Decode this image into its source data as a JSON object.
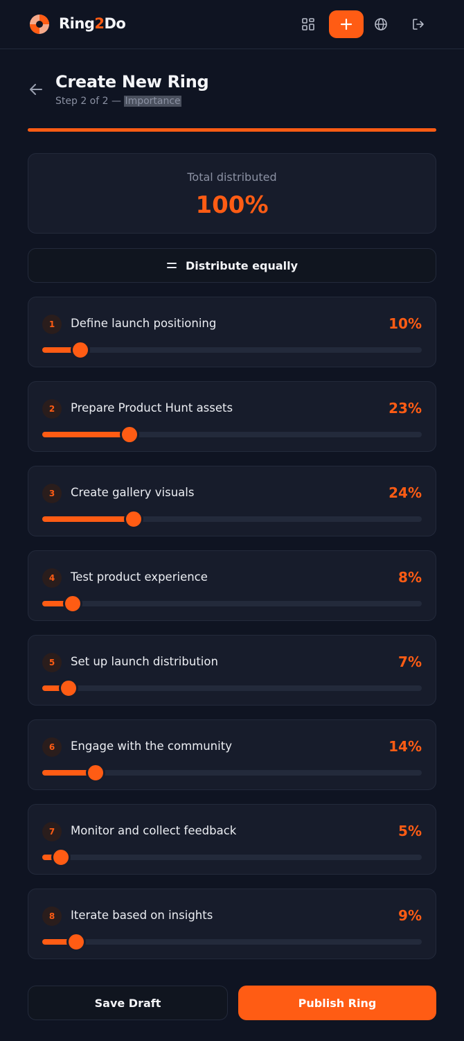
{
  "app": {
    "brand_part1": "Ring",
    "brand_part2": "2",
    "brand_part3": "Do",
    "accent_color": "#ff5c14"
  },
  "topbar": {
    "icons": [
      "grid-icon",
      "plus-icon",
      "globe-icon",
      "logout-icon"
    ]
  },
  "header": {
    "title": "Create New Ring",
    "step_text": "Step 2 of 2 — ",
    "step_name": "Importance"
  },
  "summary": {
    "label": "Total distributed",
    "value": "100%"
  },
  "distribute": {
    "icon": "equals-icon",
    "label": "Distribute equally"
  },
  "tasks": [
    {
      "num": "1",
      "name": "Define launch positioning",
      "pct_label": "10%",
      "value": 10
    },
    {
      "num": "2",
      "name": "Prepare Product Hunt assets",
      "pct_label": "23%",
      "value": 23
    },
    {
      "num": "3",
      "name": "Create gallery visuals",
      "pct_label": "24%",
      "value": 24
    },
    {
      "num": "4",
      "name": "Test product experience",
      "pct_label": "8%",
      "value": 8
    },
    {
      "num": "5",
      "name": "Set up launch distribution",
      "pct_label": "7%",
      "value": 7
    },
    {
      "num": "6",
      "name": "Engage with the community",
      "pct_label": "14%",
      "value": 14
    },
    {
      "num": "7",
      "name": "Monitor and collect feedback",
      "pct_label": "5%",
      "value": 5
    },
    {
      "num": "8",
      "name": "Iterate based on insights",
      "pct_label": "9%",
      "value": 9
    }
  ],
  "actions": {
    "save_label": "Save Draft",
    "publish_label": "Publish Ring"
  }
}
